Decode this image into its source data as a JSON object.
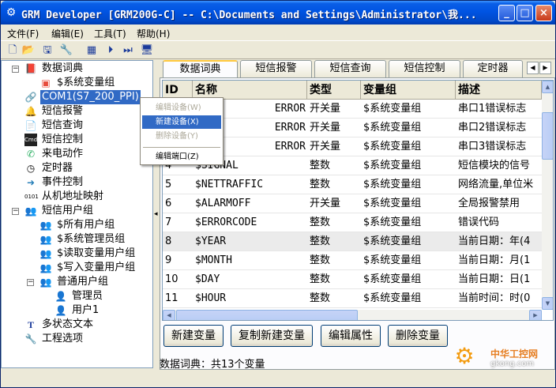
{
  "window": {
    "title": "GRM Developer [GRM200G-C]  -- C:\\Documents and Settings\\Administrator\\我...",
    "minimize": "_",
    "maximize": "□",
    "close": "×"
  },
  "menubar": {
    "file": "文件(F)",
    "edit": "编辑(E)",
    "tools": "工具(T)",
    "help": "帮助(H)"
  },
  "tree": {
    "items": [
      {
        "label": "数据词典",
        "icon": "book-icon"
      },
      {
        "label": "$系统变量组",
        "icon": "variable-group-icon"
      },
      {
        "label": "COM1(S7_200_PPI)",
        "icon": "port-icon"
      },
      {
        "label": "短信报警",
        "icon": "bell-icon"
      },
      {
        "label": "短信查询",
        "icon": "query-icon"
      },
      {
        "label": "短信控制",
        "icon": "cmd-icon"
      },
      {
        "label": "来电动作",
        "icon": "phone-icon"
      },
      {
        "label": "定时器",
        "icon": "clock-icon"
      },
      {
        "label": "事件控制",
        "icon": "event-icon"
      },
      {
        "label": "从机地址映射",
        "icon": "address-icon"
      },
      {
        "label": "短信用户组",
        "icon": "users-icon"
      },
      {
        "label": "$所有用户组",
        "icon": "users-icon"
      },
      {
        "label": "$系统管理员组",
        "icon": "users-icon"
      },
      {
        "label": "$读取变量用户组",
        "icon": "users-icon"
      },
      {
        "label": "$写入变量用户组",
        "icon": "users-icon"
      },
      {
        "label": "普通用户组",
        "icon": "users-icon"
      },
      {
        "label": "管理员",
        "icon": "user-icon"
      },
      {
        "label": "用户1",
        "icon": "user-icon"
      },
      {
        "label": "多状态文本",
        "icon": "text-icon"
      },
      {
        "label": "工程选项",
        "icon": "tools-icon"
      }
    ],
    "cmd_glyph": "Cmd",
    "addr_glyph": "0101"
  },
  "tabs": [
    "数据词典",
    "短信报警",
    "短信查询",
    "短信控制",
    "定时器"
  ],
  "grid": {
    "columns": [
      "ID",
      "名称",
      "类型",
      "变量组",
      "描述"
    ],
    "rows": [
      {
        "id": "",
        "name": "ERROR",
        "type": "开关量",
        "group": "$系统变量组",
        "desc": "串口1错误标志"
      },
      {
        "id": "",
        "name": "ERROR",
        "type": "开关量",
        "group": "$系统变量组",
        "desc": "串口2错误标志"
      },
      {
        "id": "",
        "name": "ERROR",
        "type": "开关量",
        "group": "$系统变量组",
        "desc": "串口3错误标志"
      },
      {
        "id": "4",
        "name": "$SIGNAL",
        "type": "整数",
        "group": "$系统变量组",
        "desc": "短信模块的信号"
      },
      {
        "id": "5",
        "name": "$NETTRAFFIC",
        "type": "整数",
        "group": "$系统变量组",
        "desc": "网络流量,单位米"
      },
      {
        "id": "6",
        "name": "$ALARMOFF",
        "type": "开关量",
        "group": "$系统变量组",
        "desc": "全局报警禁用"
      },
      {
        "id": "7",
        "name": "$ERRORCODE",
        "type": "整数",
        "group": "$系统变量组",
        "desc": "错误代码"
      },
      {
        "id": "8",
        "name": "$YEAR",
        "type": "整数",
        "group": "$系统变量组",
        "desc": "当前日期：年(4"
      },
      {
        "id": "9",
        "name": "$MONTH",
        "type": "整数",
        "group": "$系统变量组",
        "desc": "当前日期：月(1"
      },
      {
        "id": "10",
        "name": "$DAY",
        "type": "整数",
        "group": "$系统变量组",
        "desc": "当前日期：日(1"
      },
      {
        "id": "11",
        "name": "$HOUR",
        "type": "整数",
        "group": "$系统变量组",
        "desc": "当前时间：时(0"
      }
    ]
  },
  "buttons": {
    "new": "新建变量",
    "copy": "复制新建变量",
    "props": "编辑属性",
    "del": "删除变量"
  },
  "status": "数据词典：共13个变量",
  "context_menu": {
    "edit_device": "编辑设备(W)",
    "new_device": "新建设备(X)",
    "delete_device": "删除设备(Y)",
    "edit_port": "编辑端口(Z)"
  },
  "watermark": {
    "text": "中华工控网",
    "url": "gkong.com"
  },
  "colors": {
    "titlebar": "#0054e3",
    "selection": "#316ac5",
    "accent_tab": "#ffc83c"
  }
}
